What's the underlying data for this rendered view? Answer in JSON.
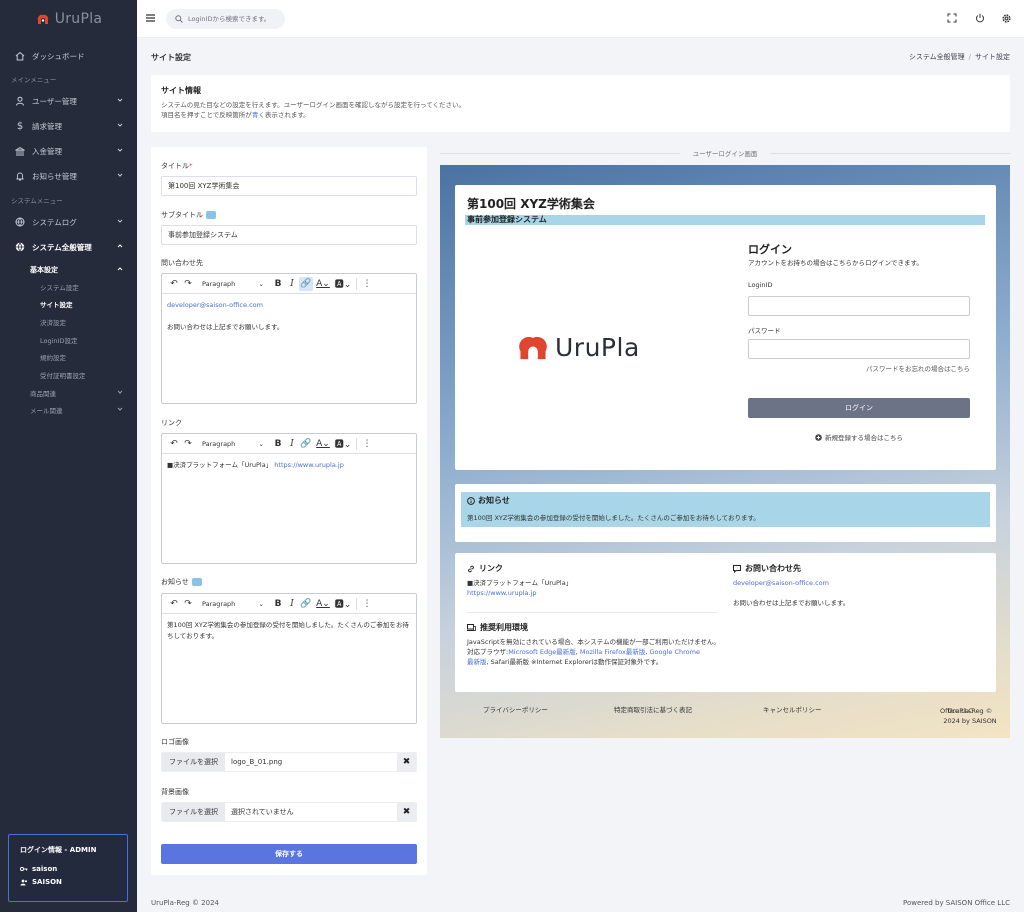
{
  "app": {
    "name": "UruPla"
  },
  "search": {
    "placeholder": "LoginIDから検索できます。"
  },
  "sidebar": {
    "dashboard": "ダッシュボード",
    "main_menu": "メインメニュー",
    "items": [
      {
        "label": "ユーザー管理",
        "icon": "user-icon"
      },
      {
        "label": "請求管理",
        "icon": "dollar-icon"
      },
      {
        "label": "入金管理",
        "icon": "bank-icon"
      },
      {
        "label": "お知らせ管理",
        "icon": "bell-icon"
      }
    ],
    "system_menu": "システムメニュー",
    "system_log": "システムログ",
    "system_all": "システム全般管理",
    "basic": "基本設定",
    "basic_items": [
      "システム設定",
      "サイト設定",
      "決済設定",
      "LoginID設定",
      "規約設定",
      "受付証明書設定"
    ],
    "product": "商品関連",
    "mail": "メール関連"
  },
  "login_info": {
    "title": "ログイン情報 - ADMIN",
    "user": "saison",
    "group": "SAISON"
  },
  "page": {
    "title": "サイト設定",
    "breadcrumb": [
      "システム全般管理",
      "サイト設定"
    ]
  },
  "info": {
    "heading": "サイト情報",
    "desc1": "システムの見た目などの設定を行えます。ユーザーログイン画面を確認しながら設定を行ってください。",
    "desc2a": "項目名を押すことで反映箇所が",
    "desc2b": "青く",
    "desc2c": "表示されます。"
  },
  "form": {
    "title_label": "タイトル",
    "title_value": "第100回 XYZ学術集会",
    "subtitle_label": "サブタイトル",
    "subtitle_value": "事前参加登録システム",
    "contact_label": "問い合わせ先",
    "contact_email": "developer@saison-office.com",
    "contact_text": "お問い合わせは上記までお願いします。",
    "link_label": "リンク",
    "link_text": "■決済プラットフォーム「UruPla」",
    "link_url": "https://www.urupla.jp",
    "notice_label": "お知らせ",
    "notice_text": "第100回 XYZ学術集会の参加登録の受付を開始しました。たくさんのご参加をお待ちしております。",
    "paragraph": "Paragraph",
    "logo_label": "ロゴ画像",
    "logo_btn": "ファイルを選択",
    "logo_file": "logo_B_01.png",
    "bg_label": "背景画像",
    "bg_btn": "ファイルを選択",
    "bg_file": "選択されていません",
    "save": "保存する"
  },
  "preview": {
    "label": "ユーザーログイン画面",
    "title": "第100回 XYZ学術集会",
    "subtitle": "事前参加登録システム",
    "login_heading": "ログイン",
    "login_desc": "アカウントをお持ちの場合はこちらからログインできます。",
    "loginid": "LoginID",
    "password": "パスワード",
    "forgot": "パスワードをお忘れの場合はこちら",
    "login_btn": "ログイン",
    "register": "新規登録する場合はこちら",
    "notice_heading": "お知らせ",
    "notice_text": "第100回 XYZ学術集会の参加登録の受付を開始しました。たくさんのご参加をお待ちしております。",
    "link_heading": "リンク",
    "link_text": "■決済プラットフォーム「UruPla」",
    "link_url": "https://www.urupla.jp",
    "contact_heading": "お問い合わせ先",
    "contact_email": "developer@saison-office.com",
    "contact_text": "お問い合わせは上記までお願いします。",
    "env_heading": "推奨利用環境",
    "env_text1": "JavaScriptを無効にされている場合、本システムの機能が一部ご利用いただけません。",
    "env_text2a": "対応ブラウザ:",
    "env_edge": "Microsoft Edge最新版",
    "env_firefox": "Mozilla Firefox最新版",
    "env_chrome1": "Google Chrome",
    "env_chrome2": "最新版",
    "env_text3": ", Safari最新版 ※Internet Explorerは動作保証対象外です。",
    "foot_privacy": "プライバシーポリシー",
    "foot_law": "特定商取引法に基づく表記",
    "foot_cancel": "キャンセルポリシー",
    "foot_copy1": "UruPla-Reg © 2024 by SAISON",
    "foot_copy2": "Office LLC"
  },
  "footer": {
    "copyright": "UruPla-Reg © 2024",
    "powered": "Powered by SAISON Office LLC"
  },
  "colors": {
    "sidebar_bg": "#262b3c",
    "accent": "#5a75e0",
    "highlight": "#a8d6e8",
    "brand_red": "#e0452f"
  }
}
